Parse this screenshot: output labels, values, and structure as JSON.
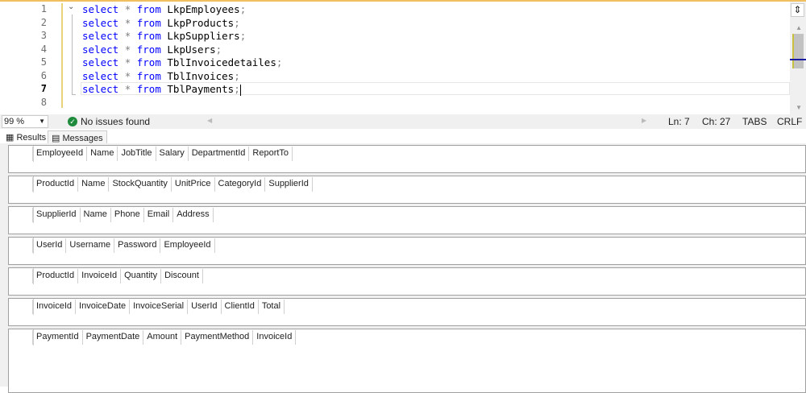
{
  "editor": {
    "lines": [
      {
        "n": "1",
        "kw1": "select",
        "op": "*",
        "kw2": "from",
        "table": "LkpEmployees",
        "end": ";"
      },
      {
        "n": "2",
        "kw1": "select",
        "op": "*",
        "kw2": "from",
        "table": "LkpProducts",
        "end": ";"
      },
      {
        "n": "3",
        "kw1": "select",
        "op": "*",
        "kw2": "from",
        "table": "LkpSuppliers",
        "end": ";"
      },
      {
        "n": "4",
        "kw1": "select",
        "op": "*",
        "kw2": "from",
        "table": "LkpUsers",
        "end": ";"
      },
      {
        "n": "5",
        "kw1": "select",
        "op": "*",
        "kw2": "from",
        "table": "TblInvoicedetailes",
        "end": ";"
      },
      {
        "n": "6",
        "kw1": "select",
        "op": "*",
        "kw2": "from",
        "table": "TblInvoices",
        "end": ";"
      },
      {
        "n": "7",
        "kw1": "select",
        "op": "*",
        "kw2": "from",
        "table": "TblPayments",
        "end": ";"
      }
    ],
    "empty_line": "8"
  },
  "status": {
    "zoom": "99 %",
    "issues": "No issues found",
    "ln": "Ln: 7",
    "ch": "Ch: 27",
    "tabs": "TABS",
    "eol": "CRLF"
  },
  "tabs": {
    "results": "Results",
    "messages": "Messages"
  },
  "grids": [
    [
      "EmployeeId",
      "Name",
      "JobTitle",
      "Salary",
      "DepartmentId",
      "ReportTo"
    ],
    [
      "ProductId",
      "Name",
      "StockQuantity",
      "UnitPrice",
      "CategoryId",
      "SupplierId"
    ],
    [
      "SupplierId",
      "Name",
      "Phone",
      "Email",
      "Address"
    ],
    [
      "UserId",
      "Username",
      "Password",
      "EmployeeId"
    ],
    [
      "ProductId",
      "InvoiceId",
      "Quantity",
      "Discount"
    ],
    [
      "InvoiceId",
      "InvoiceDate",
      "InvoiceSerial",
      "UserId",
      "ClientId",
      "Total"
    ],
    [
      "PaymentId",
      "PaymentDate",
      "Amount",
      "PaymentMethod",
      "InvoiceId"
    ]
  ]
}
